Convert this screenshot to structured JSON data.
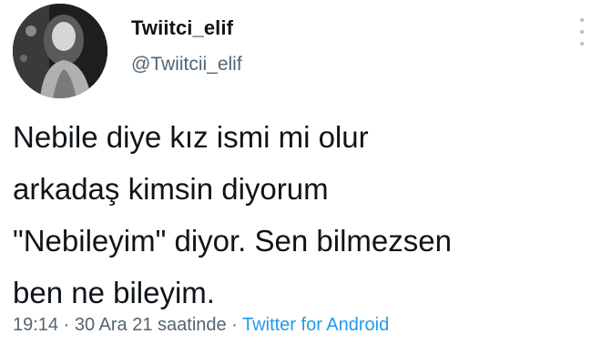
{
  "user": {
    "display_name": "Twiitci_elif",
    "handle": "@Twiitcii_elif"
  },
  "tweet": {
    "text": "Nebile diye kız ismi mi olur\narkadaş kimsin diyorum\n\"Nebileyim\" diyor. Sen bilmezsen\nben ne bileyim."
  },
  "meta": {
    "time": "19:14",
    "separator": " · ",
    "date": "30 Ara 21 saatinde",
    "source": "Twitter for Android"
  },
  "colors": {
    "text": "#0f1419",
    "secondary": "#536471",
    "link": "#1d9bf0"
  },
  "icons": {
    "more": "more-vertical-icon"
  }
}
